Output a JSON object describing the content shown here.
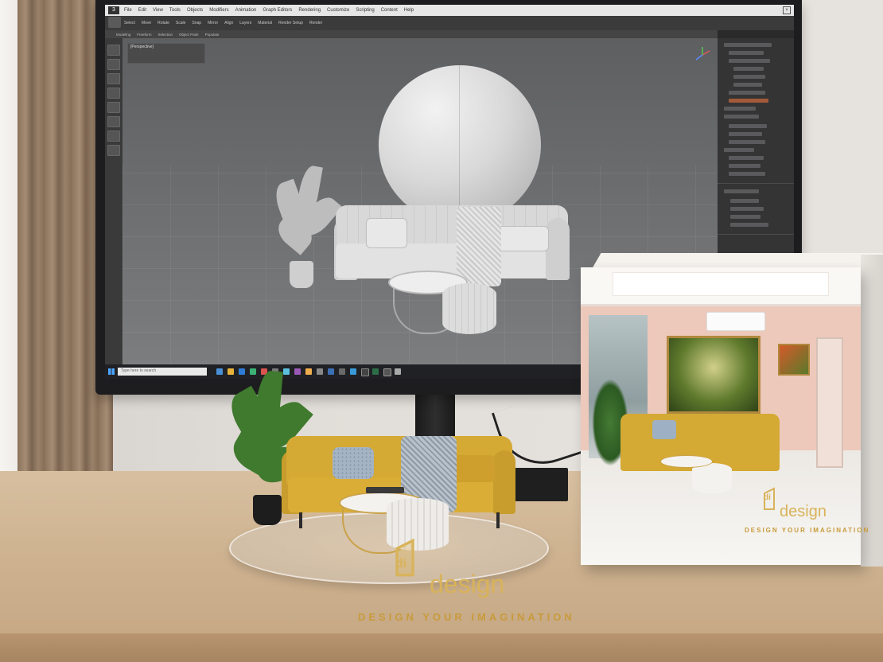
{
  "scene": {
    "description_colors": {
      "sofa": "#d4a934",
      "wall": "#e2ded9",
      "desk": "#cfb492",
      "brand_gold": "#d8b35a"
    }
  },
  "software_ui": {
    "menu": [
      "File",
      "Edit",
      "View",
      "Tools",
      "Objects",
      "Modifiers",
      "Animation",
      "Graph Editors",
      "Rendering",
      "Customize",
      "Scripting",
      "Content",
      "Help"
    ],
    "toolbar": [
      "Select",
      "Move",
      "Rotate",
      "Scale",
      "Snap",
      "Mirror",
      "Align",
      "Layers",
      "Material",
      "Render Setup",
      "Render"
    ],
    "command_bar": [
      "Modeling",
      "Freeform",
      "Selection",
      "Object Paint",
      "Populate"
    ],
    "viewport_label": "[Perspective]",
    "search_placeholder": "Type here to search",
    "icons": [
      "gear-icon",
      "move-icon",
      "rotate-icon",
      "scale-icon",
      "windows-start-icon",
      "folder-icon",
      "browser-icon"
    ]
  },
  "branding": {
    "logo_letters": "di",
    "name": "design",
    "tagline": "DESIGN YOUR IMAGINATION"
  }
}
